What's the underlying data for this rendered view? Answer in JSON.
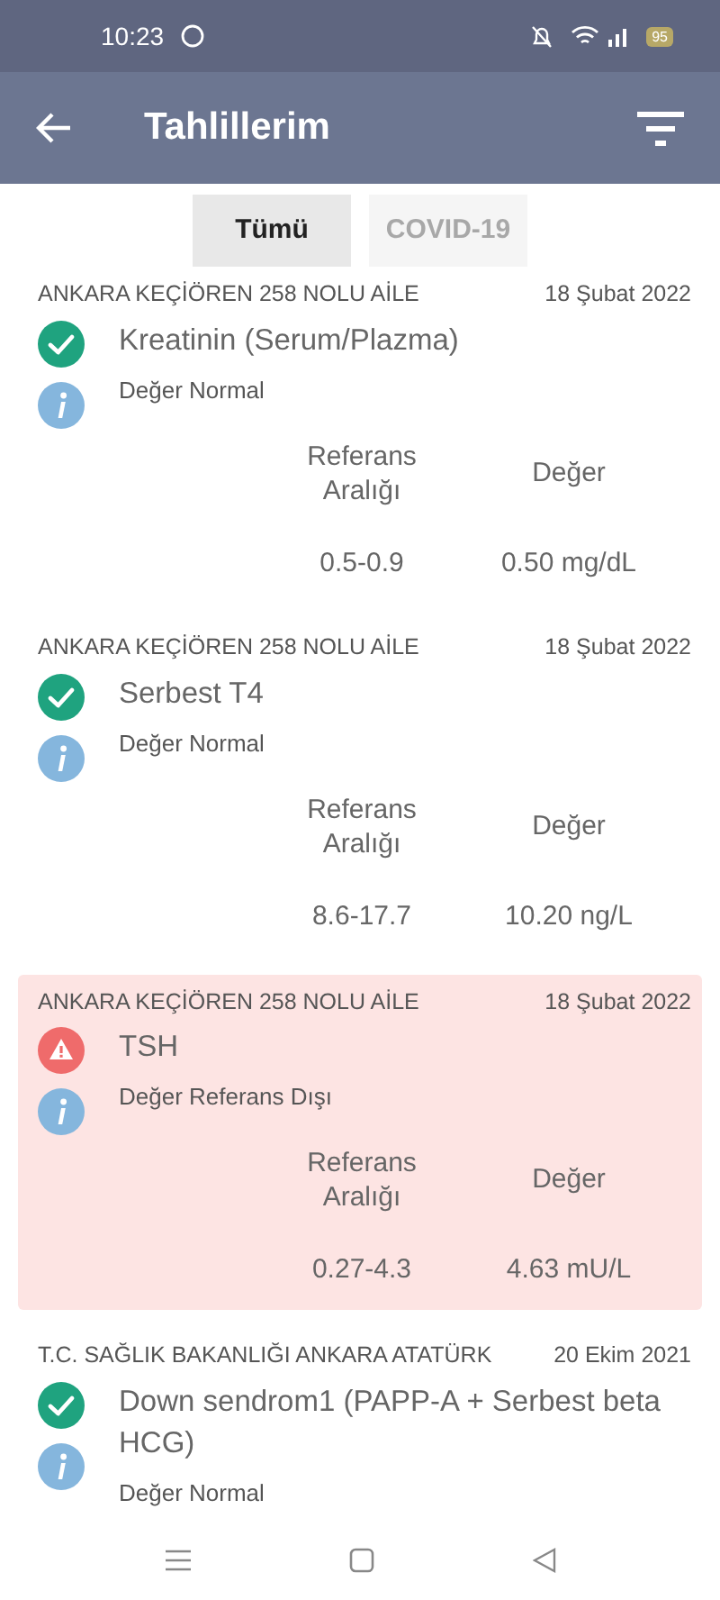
{
  "status_bar": {
    "time": "10:23",
    "battery": "95"
  },
  "header": {
    "title": "Tahlillerim"
  },
  "tabs": [
    {
      "label": "Tümü",
      "selected": true
    },
    {
      "label": "COVID-19",
      "selected": false
    }
  ],
  "results": [
    {
      "institution": "ANKARA KEÇİÖREN 258 NOLU AİLE",
      "date": "18 Şubat 2022",
      "name": "Kreatinin (Serum/Plazma)",
      "kind": "normal",
      "status": "Değer Normal",
      "table": {
        "ref_header": "Referans Aralığı",
        "value_header": "Değer",
        "ref": "0.5-0.9",
        "value": "0.50 mg/dL"
      }
    },
    {
      "institution": "ANKARA KEÇİÖREN 258 NOLU AİLE",
      "date": "18 Şubat 2022",
      "name": "Serbest T4",
      "kind": "normal",
      "status": "Değer Normal",
      "table": {
        "ref_header": "Referans Aralığı",
        "value_header": "Değer",
        "ref": "8.6-17.7",
        "value": "10.20 ng/L"
      }
    },
    {
      "institution": "ANKARA KEÇİÖREN 258 NOLU AİLE",
      "date": "18 Şubat 2022",
      "name": "TSH",
      "kind": "abnormal",
      "status": "Değer Referans Dışı",
      "table": {
        "ref_header": "Referans Aralığı",
        "value_header": "Değer",
        "ref": "0.27-4.3",
        "value": "4.63 mU/L"
      }
    },
    {
      "institution": "T.C. SAĞLIK BAKANLIĞI ANKARA ATATÜRK",
      "date": "20 Ekim 2021",
      "name": "Down sendrom1 (PAPP-A + Serbest beta HCG)",
      "kind": "normal",
      "status": "Değer Normal"
    }
  ]
}
